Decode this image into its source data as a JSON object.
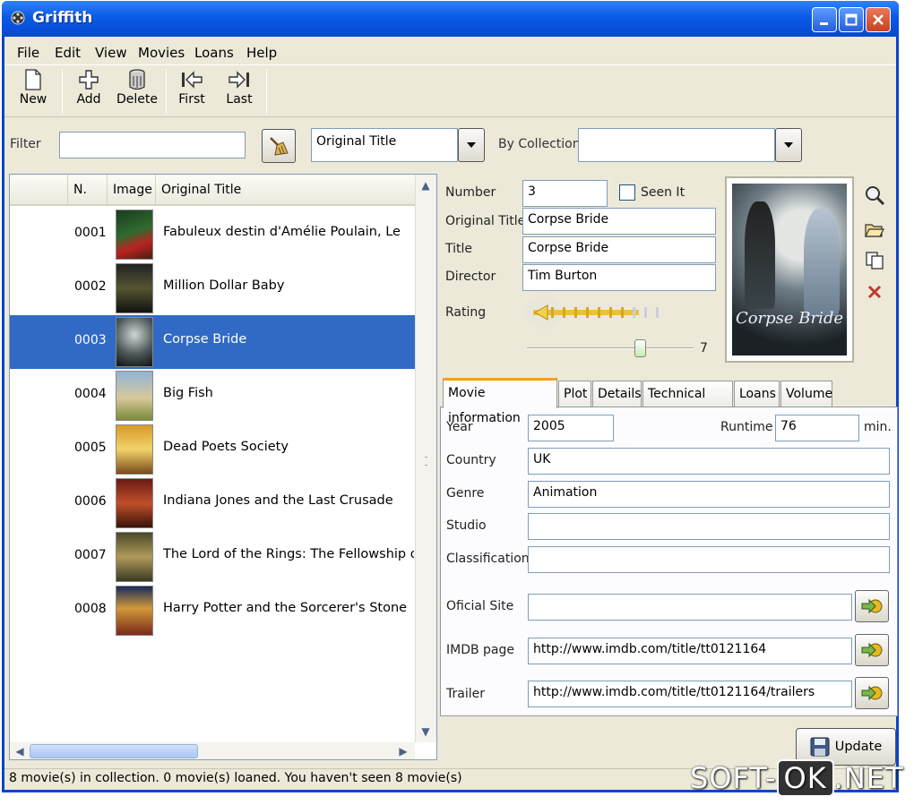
{
  "window": {
    "title": "Griffith"
  },
  "menu": [
    "File",
    "Edit",
    "View",
    "Movies",
    "Loans",
    "Help"
  ],
  "toolbar": {
    "new": "New",
    "add": "Add",
    "delete": "Delete",
    "first": "First",
    "last": "Last"
  },
  "filter": {
    "label": "Filter",
    "value": "",
    "field_selected": "Original Title",
    "collection_label": "By Collection",
    "collection_value": ""
  },
  "list": {
    "headers": [
      "N.",
      "Image",
      "Original Title"
    ],
    "rows": [
      {
        "num": "0001",
        "title": "Fabuleux destin d'Amélie Poulain, Le"
      },
      {
        "num": "0002",
        "title": "Million Dollar Baby"
      },
      {
        "num": "0003",
        "title": "Corpse Bride"
      },
      {
        "num": "0004",
        "title": "Big Fish"
      },
      {
        "num": "0005",
        "title": "Dead Poets Society"
      },
      {
        "num": "0006",
        "title": "Indiana Jones and the Last Crusade"
      },
      {
        "num": "0007",
        "title": "The Lord of the Rings: The Fellowship of th"
      },
      {
        "num": "0008",
        "title": "Harry Potter and the Sorcerer's Stone"
      }
    ],
    "selected_index": 2
  },
  "details": {
    "number_label": "Number",
    "number": "3",
    "seen_label": "Seen It",
    "seen": false,
    "original_title_label": "Original Title",
    "original_title": "Corpse Bride",
    "title_label": "Title",
    "title": "Corpse Bride",
    "director_label": "Director",
    "director": "Tim Burton",
    "rating_label": "Rating",
    "rating": "7",
    "rating_max": 10
  },
  "poster": {
    "caption": "Corpse Bride"
  },
  "tabs": [
    "Movie information",
    "Plot",
    "Details",
    "Technical info",
    "Loans",
    "Volume"
  ],
  "info": {
    "year_label": "Year",
    "year": "2005",
    "runtime_label": "Runtime",
    "runtime": "76",
    "runtime_unit": "min.",
    "country_label": "Country",
    "country": "UK",
    "genre_label": "Genre",
    "genre": "Animation",
    "studio_label": "Studio",
    "studio": "",
    "classification_label": "Classification",
    "classification": "",
    "site_label": "Oficial Site",
    "site": "",
    "imdb_label": "IMDB page",
    "imdb": "http://www.imdb.com/title/tt0121164",
    "trailer_label": "Trailer",
    "trailer": "http://www.imdb.com/title/tt0121164/trailers"
  },
  "update_label": "Update",
  "status": "8 movie(s) in collection. 0 movie(s) loaned. You haven't seen 8 movie(s)",
  "watermark": {
    "left": "SOFT-",
    "box": "OK",
    "right": ".NET"
  },
  "colors": {
    "selection": "#316ac5",
    "titlebar": "#0a5ae6",
    "window_bg": "#ece9d8"
  }
}
